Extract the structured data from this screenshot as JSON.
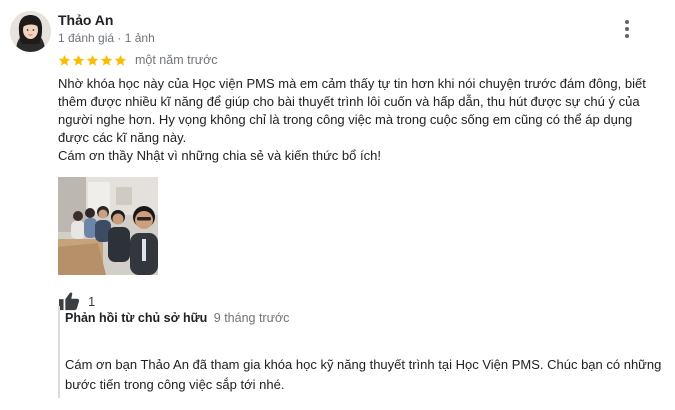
{
  "review": {
    "reviewer_name": "Thảo An",
    "reviewer_meta": "1 đánh giá · 1 ảnh",
    "rating": 5,
    "star_color": "#fbbc04",
    "date": "một năm trước",
    "paragraphs": [
      "Nhờ khóa học này của Học viện PMS mà em cảm thấy tự tin hơn khi nói chuyện trước đám đông, biết thêm được nhiều kĩ năng để giúp cho bài thuyết trình lôi cuốn và hấp dẫn, thu hút được sự chú ý của người nghe hơn. Hy vọng không chỉ là trong công việc mà trong cuộc sống em cũng có thể áp dụng được các kĩ năng này.",
      "Cám ơn thầy Nhật vì những chia sẻ và kiến thức bổ ích!"
    ],
    "photo_icon": "group-selfie-photo",
    "likes": "1",
    "like_icon": "thumbs-up-icon",
    "more_icon": "more-vert-icon"
  },
  "owner_reply": {
    "label": "Phản hồi từ chủ sở hữu",
    "date": "9 tháng trước",
    "text": "Cám ơn bạn Thảo An đã tham gia khóa học kỹ năng thuyết trình tại Học Viện PMS. Chúc bạn có những bước tiến trong công việc sắp tới nhé."
  }
}
